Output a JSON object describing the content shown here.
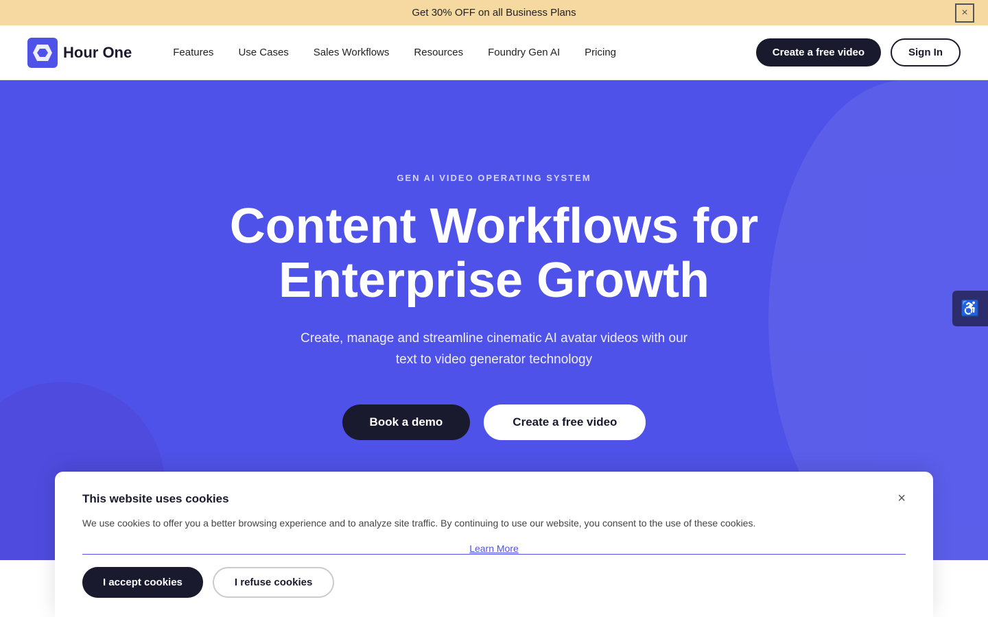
{
  "banner": {
    "text": "Get 30% OFF on all Business Plans",
    "close_label": "×"
  },
  "navbar": {
    "logo_text": "Hour One",
    "links": [
      {
        "label": "Features",
        "id": "features"
      },
      {
        "label": "Use Cases",
        "id": "use-cases"
      },
      {
        "label": "Sales Workflows",
        "id": "sales-workflows"
      },
      {
        "label": "Resources",
        "id": "resources"
      },
      {
        "label": "Foundry Gen AI",
        "id": "foundry-gen-ai"
      },
      {
        "label": "Pricing",
        "id": "pricing"
      }
    ],
    "create_btn": "Create a free video",
    "signin_btn": "Sign In"
  },
  "hero": {
    "eyebrow": "GEN AI VIDEO OPERATING SYSTEM",
    "title_line1": "Content Workflows for",
    "title_line2": "Enterprise Growth",
    "subtitle": "Create, manage and streamline cinematic AI avatar videos with our text to video generator technology",
    "btn_demo": "Book a demo",
    "btn_create": "Create a free video"
  },
  "accessibility": {
    "icon": "♿",
    "label": "Accessibility"
  },
  "cookie": {
    "title": "This website uses cookies",
    "body": "We use cookies to offer you a better browsing experience and to analyze site traffic. By continuing to use our website, you consent to the use of these cookies.",
    "learn_more": "Learn More",
    "accept_btn": "I accept cookies",
    "refuse_btn": "I refuse cookies",
    "close_label": "×"
  }
}
